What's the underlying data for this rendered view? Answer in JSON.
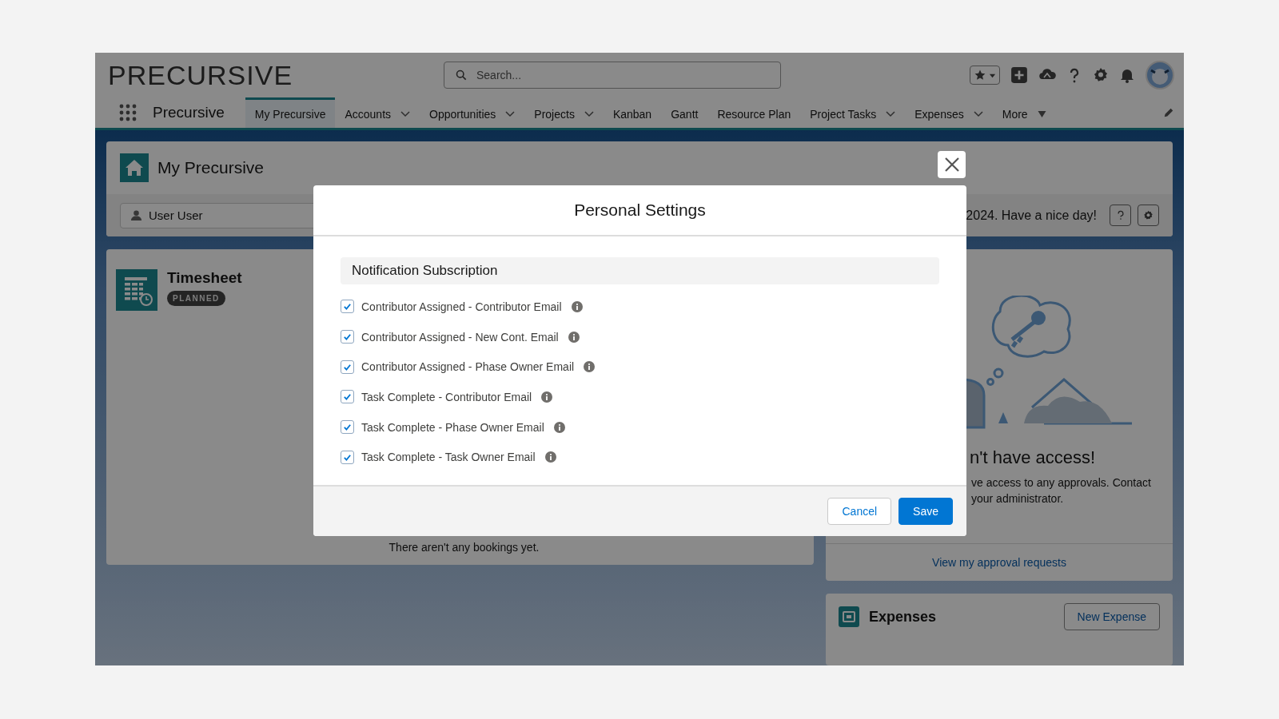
{
  "app": {
    "logo": "PRE**CURSIVE**",
    "search": {
      "placeholder": "Search..."
    },
    "app_name": "Precursive",
    "tabs": [
      {
        "label": "My Precursive",
        "selected": true,
        "kind": "plain"
      },
      {
        "label": "Accounts",
        "selected": false,
        "kind": "dropdown"
      },
      {
        "label": "Opportunities",
        "selected": false,
        "kind": "dropdown"
      },
      {
        "label": "Projects",
        "selected": false,
        "kind": "dropdown"
      },
      {
        "label": "Kanban",
        "selected": false,
        "kind": "plain"
      },
      {
        "label": "Gantt",
        "selected": false,
        "kind": "plain"
      },
      {
        "label": "Resource Plan",
        "selected": false,
        "kind": "plain"
      },
      {
        "label": "Project Tasks",
        "selected": false,
        "kind": "dropdown"
      },
      {
        "label": "Expenses",
        "selected": false,
        "kind": "dropdown"
      },
      {
        "label": "More",
        "selected": false,
        "kind": "more"
      }
    ]
  },
  "page_header": {
    "title": "My Precursive",
    "user": "User User",
    "greeting": "2024. Have a nice day!"
  },
  "timesheet": {
    "title": "Timesheet",
    "badge": "PLANNED",
    "empty_text": "There aren't any bookings yet."
  },
  "approvals": {
    "heading": "n't have access!",
    "message_lines": [
      "ve access to any approvals. Contact",
      "your administrator."
    ],
    "link": "View my approval requests"
  },
  "expenses": {
    "title": "Expenses",
    "button": "New Expense"
  },
  "modal": {
    "title": "Personal Settings",
    "section": "Notification Subscription",
    "options": [
      {
        "label": "Contributor Assigned - Contributor Email",
        "checked": true
      },
      {
        "label": "Contributor Assigned - New Cont. Email",
        "checked": true
      },
      {
        "label": "Contributor Assigned - Phase Owner Email",
        "checked": true
      },
      {
        "label": "Task Complete - Contributor Email",
        "checked": true
      },
      {
        "label": "Task Complete - Phase Owner Email",
        "checked": true
      },
      {
        "label": "Task Complete - Task Owner Email",
        "checked": true
      }
    ],
    "buttons": [
      {
        "label": "Cancel",
        "kind": "neutral"
      },
      {
        "label": "Save",
        "kind": "brand"
      }
    ]
  }
}
